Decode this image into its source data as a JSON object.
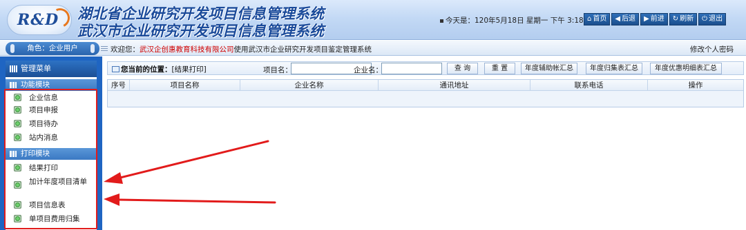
{
  "header": {
    "logo_text": "R&D",
    "title_line1": "湖北省企业研究开发项目信息管理系统",
    "title_line2": "武汉市企业研究开发项目信息管理系统",
    "today_label": "今天是：",
    "today_value": "120年5月18日 星期一 下午 3:18:13",
    "nav": [
      {
        "label": "首页",
        "icon": "home-icon",
        "glyph": "⌂"
      },
      {
        "label": "后退",
        "icon": "arrow-left-icon",
        "glyph": "◀"
      },
      {
        "label": "前进",
        "icon": "arrow-right-icon",
        "glyph": "▶"
      },
      {
        "label": "刷新",
        "icon": "refresh-icon",
        "glyph": "↻"
      },
      {
        "label": "退出",
        "icon": "power-icon",
        "glyph": "⏻"
      }
    ]
  },
  "bar": {
    "role": "角色：企业用户",
    "welcome_prefix": "欢迎您：",
    "company": "武汉企创惠教育科技有限公司",
    "welcome_suffix": "使用武汉市企业研究开发项目鉴定管理系统",
    "change_password": "修改个人密码"
  },
  "sidebar": {
    "title": "管理菜单",
    "modules": [
      {
        "name": "功能模块",
        "items": [
          "企业信息",
          "项目申报",
          "项目待办",
          "站内消息"
        ]
      },
      {
        "name": "打印模块",
        "items": [
          "结果打印",
          "加计年度项目清单",
          "项目信息表",
          "单项目费用归集"
        ]
      }
    ]
  },
  "toolbar": {
    "location_label": "您当前的位置：",
    "location_value": "[结果打印]",
    "project_label": "项目名：",
    "project_value": "",
    "company_label": "企业名：",
    "company_value": "",
    "buttons": [
      "查 询",
      "重 置",
      "年度辅助帐汇总",
      "年度归集表汇总",
      "年度优惠明细表汇总"
    ]
  },
  "table": {
    "columns": [
      "序号",
      "项目名称",
      "企业名称",
      "通讯地址",
      "联系电话",
      "操作"
    ]
  },
  "colors": {
    "header_bg": "#c3d9f5",
    "sidebar_bg": "#1f65c2",
    "title_blue": "#1a4a9a",
    "company_red": "#d00000",
    "annotation_red": "#e21b1b"
  }
}
